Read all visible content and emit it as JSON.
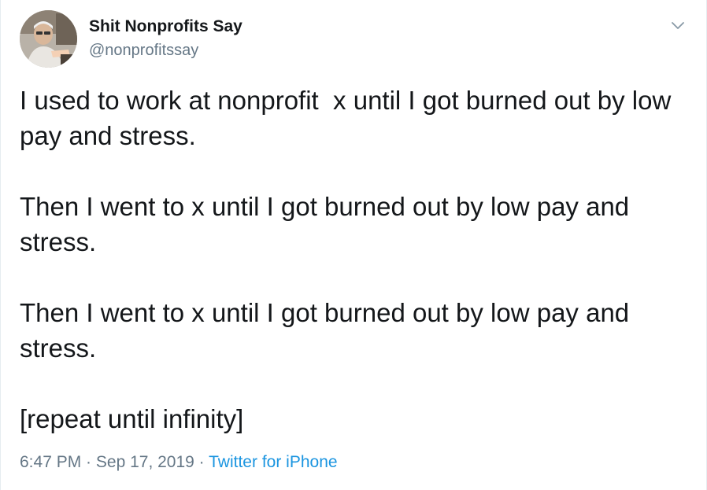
{
  "user": {
    "display_name": "Shit Nonprofits Say",
    "handle": "@nonprofitssay",
    "avatar_icon": "user-photo"
  },
  "tweet": {
    "paragraphs": [
      "I used to work at nonprofit  x until I got burned out by low pay and stress.",
      "Then I went to x until I got burned out by low pay and stress.",
      "Then I went to x until I got burned out by low pay and stress.",
      "[repeat until infinity]"
    ]
  },
  "meta": {
    "time": "6:47 PM",
    "separator": " · ",
    "date": "Sep 17, 2019",
    "source": "Twitter for iPhone"
  },
  "colors": {
    "text": "#14171a",
    "secondary": "#657786",
    "link": "#1b95e0"
  },
  "icons": {
    "caret": "chevron-down-icon"
  }
}
